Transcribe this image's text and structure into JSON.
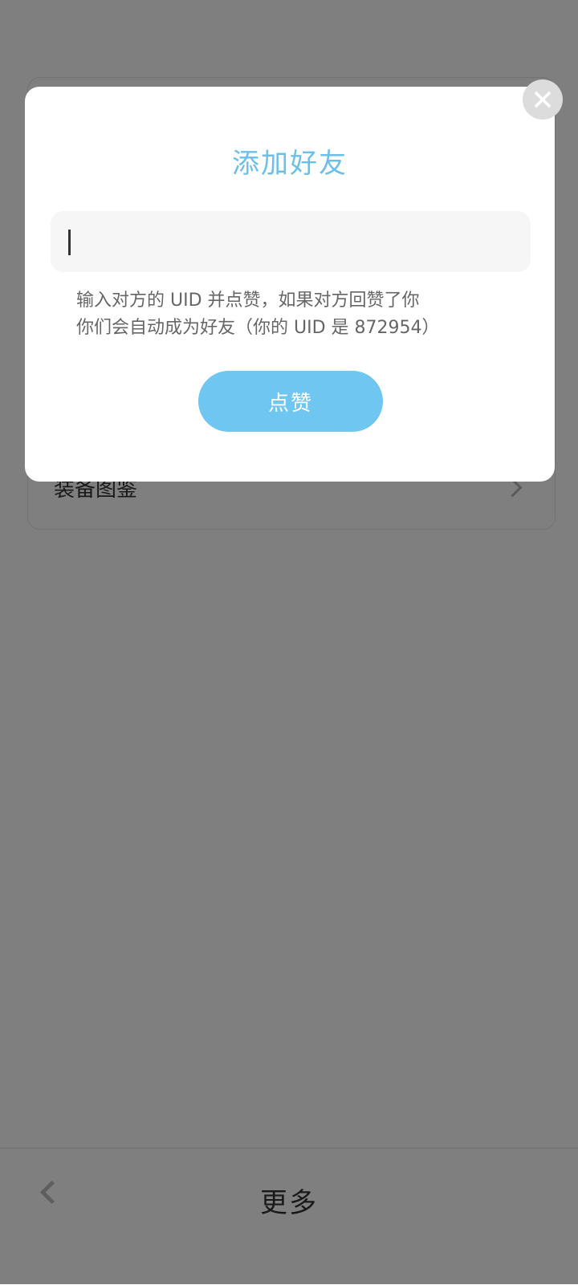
{
  "background": {
    "menu_item_label": "装备图鉴",
    "bottom_bar_title": "更多"
  },
  "dialog": {
    "title": "添加好友",
    "input_value": "",
    "hint_line1": "输入对方的 UID 并点赞，如果对方回赞了你",
    "hint_line2": "你们会自动成为好友（你的 UID 是 872954）",
    "like_button_label": "点赞"
  },
  "icons": {
    "close": "close-icon",
    "back": "chevron-left-icon",
    "menu_arrow": "chevron-right-icon"
  },
  "colors": {
    "accent": "#6ac0ea",
    "button": "#6ec6f1",
    "overlay": "rgba(0,0,0,0.5)"
  }
}
